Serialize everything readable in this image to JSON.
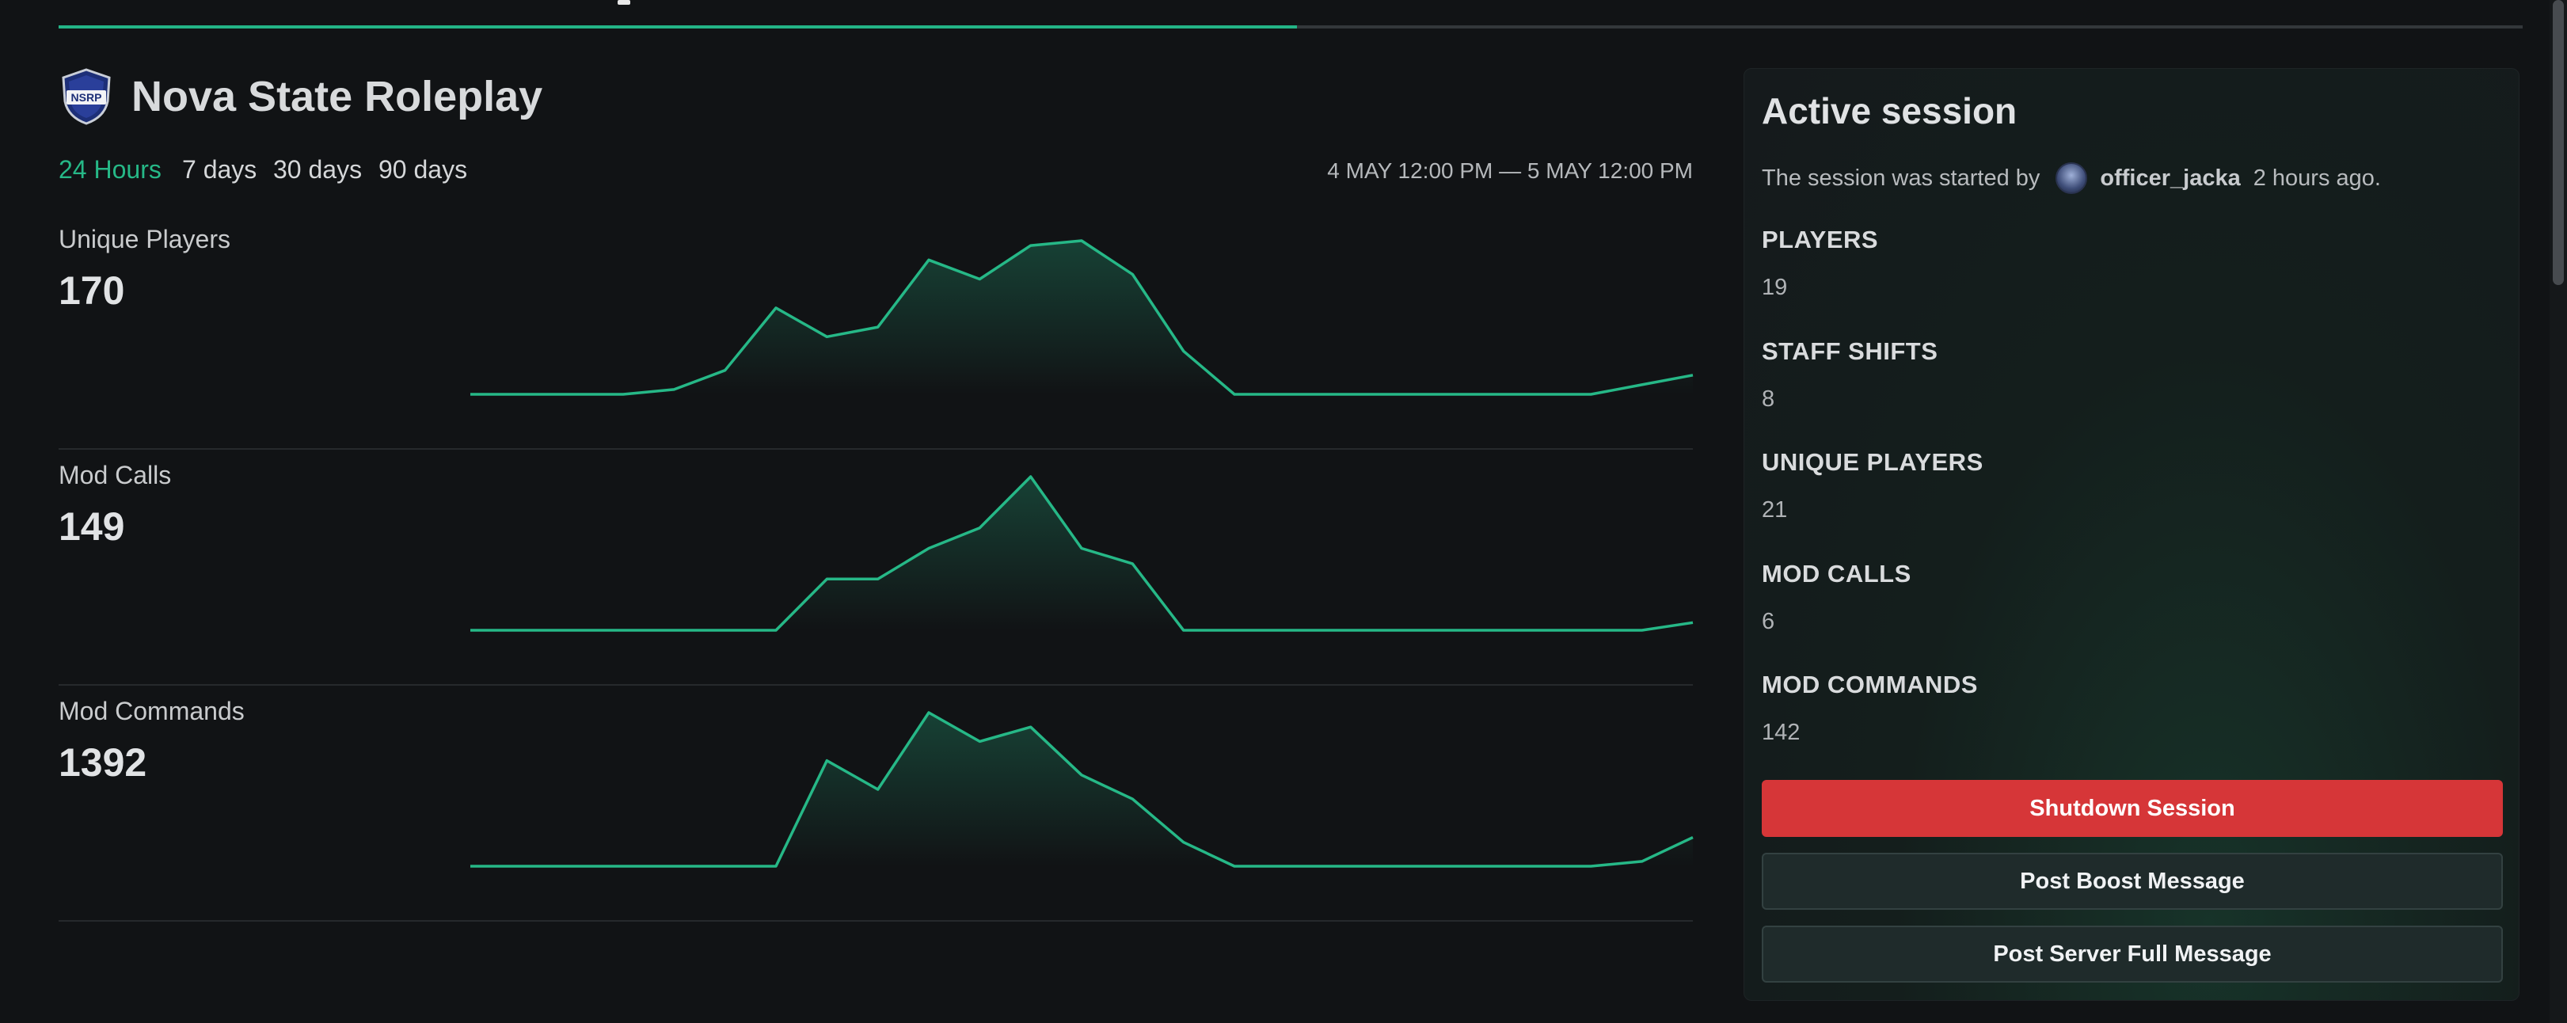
{
  "nav": {
    "tab_icons": [
      "user-icon",
      "gear-icon"
    ]
  },
  "server": {
    "name": "Nova State Roleplay",
    "logo_text": "NSRP",
    "logo_icon": "shield-badge-icon"
  },
  "time_ranges": {
    "options": [
      "24 Hours",
      "7 days",
      "30 days",
      "90 days"
    ],
    "selected": "24 Hours"
  },
  "date_range": "4 MAY 12:00 PM — 5 MAY 12:00 PM",
  "stats": [
    {
      "label": "Unique Players",
      "value": "170"
    },
    {
      "label": "Mod Calls",
      "value": "149"
    },
    {
      "label": "Mod Commands",
      "value": "1392"
    }
  ],
  "colors": {
    "accent": "#26b887",
    "danger": "#d63638",
    "background": "#111315",
    "panel_button": "#1f2b2b"
  },
  "chart_data": [
    {
      "type": "area",
      "series": [
        {
          "values": [
            0,
            0,
            0,
            0,
            1,
            5,
            18,
            12,
            14,
            28,
            24,
            31,
            32,
            25,
            9,
            0,
            0,
            0,
            0,
            0,
            0,
            0,
            0,
            2,
            4
          ]
        }
      ]
    },
    {
      "type": "area",
      "series": [
        {
          "values": [
            0,
            0,
            0,
            0,
            0,
            0,
            0,
            10,
            10,
            16,
            20,
            30,
            16,
            13,
            0,
            0,
            0,
            0,
            0,
            0,
            0,
            0,
            0,
            0,
            1.5
          ]
        }
      ]
    },
    {
      "type": "area",
      "series": [
        {
          "values": [
            0,
            0,
            0,
            0,
            0,
            0,
            0,
            22,
            16,
            32,
            26,
            29,
            19,
            14,
            5,
            0,
            0,
            0,
            0,
            0,
            0,
            0,
            0,
            1,
            6
          ]
        }
      ]
    }
  ],
  "session": {
    "title": "Active session",
    "started_prefix": "The session was started by",
    "started_by": "officer_jacka",
    "started_ago": "2 hours ago.",
    "stats": [
      {
        "key": "PLAYERS",
        "value": "19"
      },
      {
        "key": "STAFF SHIFTS",
        "value": "8"
      },
      {
        "key": "UNIQUE PLAYERS",
        "value": "21"
      },
      {
        "key": "MOD CALLS",
        "value": "6"
      },
      {
        "key": "MOD COMMANDS",
        "value": "142"
      }
    ],
    "buttons": {
      "shutdown": "Shutdown Session",
      "boost": "Post Boost Message",
      "full": "Post Server Full Message"
    }
  }
}
